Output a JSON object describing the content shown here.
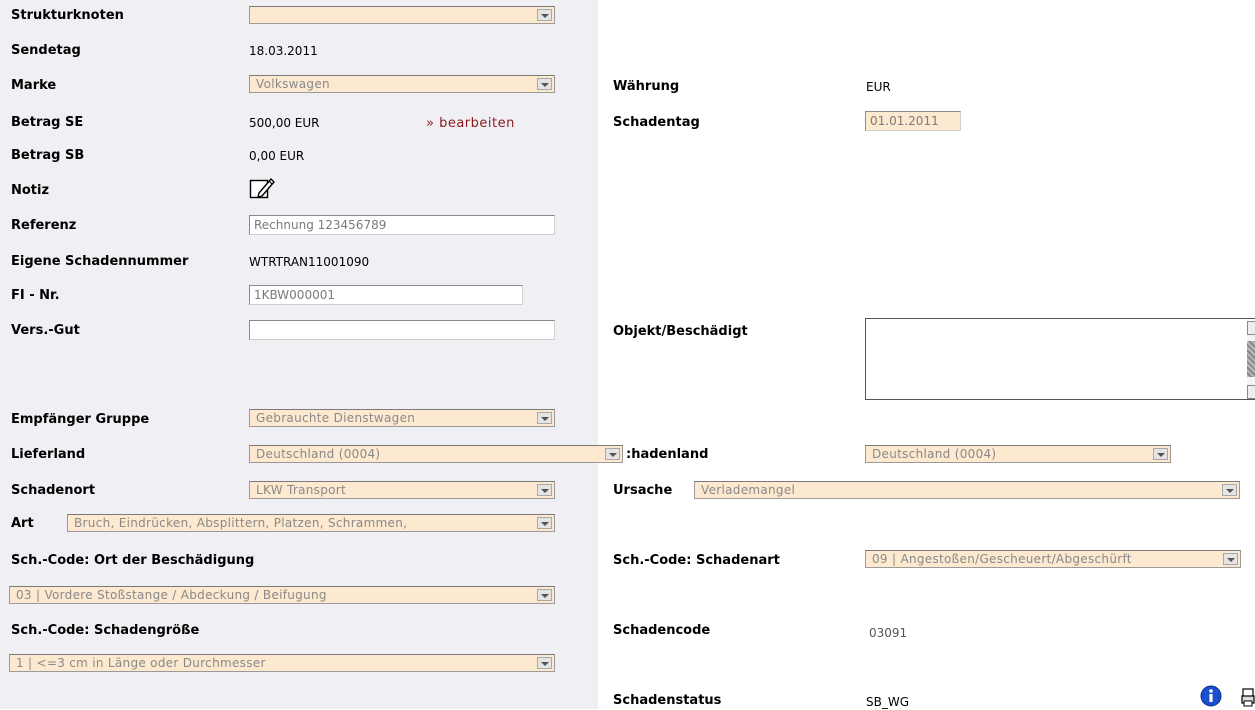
{
  "left": {
    "strukturknoten": {
      "label": "Strukturknoten",
      "value": ""
    },
    "sendetag": {
      "label": "Sendetag",
      "value": "18.03.2011"
    },
    "marke": {
      "label": "Marke",
      "value": "Volkswagen"
    },
    "betrag_se": {
      "label": "Betrag SE",
      "value": "500,00 EUR",
      "link": "» bearbeiten"
    },
    "betrag_sb": {
      "label": "Betrag SB",
      "value": "0,00 EUR"
    },
    "notiz": {
      "label": "Notiz",
      "icon": "note-edit-icon"
    },
    "referenz": {
      "label": "Referenz",
      "value": "Rechnung 123456789"
    },
    "eigene_schadennummer": {
      "label": "Eigene Schadennummer",
      "value": "WTRTRAN11001090"
    },
    "fi_nr": {
      "label": "FI - Nr.",
      "value": "1KBW000001"
    },
    "vers_gut": {
      "label": "Vers.-Gut",
      "value": ""
    },
    "empfaenger_gruppe": {
      "label": "Empfänger Gruppe",
      "value": "Gebrauchte Dienstwagen"
    },
    "lieferland": {
      "label": "Lieferland",
      "value": "Deutschland (0004)"
    },
    "schadenort": {
      "label": "Schadenort",
      "value": "LKW Transport"
    },
    "art": {
      "label": "Art",
      "value": "Bruch, Eindrücken, Absplittern, Platzen, Schrammen,"
    },
    "sch_code_ort": {
      "label": "Sch.-Code: Ort der Beschädigung",
      "value": "03 | Vordere Stoßstange / Abdeckung / Beifugung"
    },
    "sch_code_groesse": {
      "label": "Sch.-Code: Schadengröße",
      "value": "1 | <=3 cm in Länge oder Durchmesser"
    }
  },
  "right": {
    "waehrung": {
      "label": "Währung",
      "value": "EUR"
    },
    "schadentag": {
      "label": "Schadentag",
      "value": "01.01.2011"
    },
    "objekt_beschaedigt": {
      "label": "Objekt/Beschädigt",
      "value": ""
    },
    "schadenland": {
      "label": ":hadenland",
      "value": "Deutschland (0004)"
    },
    "ursache": {
      "label": "Ursache",
      "value": "Verlademangel"
    },
    "sch_code_schadenart": {
      "label": "Sch.-Code: Schadenart",
      "value": "09 | Angestoßen/Gescheuert/Abgeschürft"
    },
    "schadencode": {
      "label": "Schadencode",
      "value": "03091"
    },
    "schadenstatus": {
      "label": "Schadenstatus",
      "value": "SB_WG",
      "icons": [
        "info-icon",
        "print-icon"
      ]
    }
  },
  "colors": {
    "left_bg": "#efeff4",
    "field_bg": "#fde8d0",
    "link": "#8b1a1a",
    "info": "#1a4fd0"
  }
}
